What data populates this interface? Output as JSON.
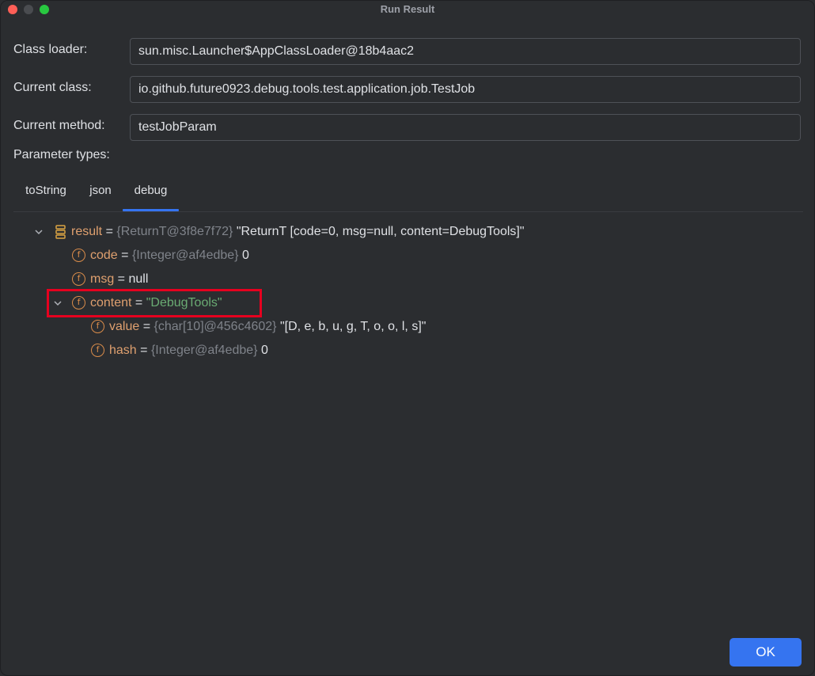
{
  "window": {
    "title": "Run Result"
  },
  "fields": {
    "class_loader": {
      "label": "Class loader:",
      "value": "sun.misc.Launcher$AppClassLoader@18b4aac2"
    },
    "current_class": {
      "label": "Current class:",
      "value": "io.github.future0923.debug.tools.test.application.job.TestJob"
    },
    "current_method": {
      "label": "Current method:",
      "value": "testJobParam"
    },
    "parameter_types": {
      "label": "Parameter types:"
    }
  },
  "tabs": [
    {
      "label": "toString"
    },
    {
      "label": "json"
    },
    {
      "label": "debug",
      "active": true
    }
  ],
  "tree": {
    "result": {
      "name": "result",
      "eq": " = ",
      "type": "{ReturnT@3f8e7f72}",
      "value": " \"ReturnT [code=0, msg=null, content=DebugTools]\""
    },
    "code": {
      "name": "code",
      "eq": " = ",
      "type": "{Integer@af4edbe}",
      "value": " 0"
    },
    "msg": {
      "name": "msg",
      "eq": " = ",
      "value": " null"
    },
    "content": {
      "name": "content",
      "eq": " = ",
      "value": " \"DebugTools\""
    },
    "value": {
      "name": "value",
      "eq": " = ",
      "type": "{char[10]@456c4602}",
      "value": " \"[D, e, b, u, g, T, o, o, l, s]\""
    },
    "hash": {
      "name": "hash",
      "eq": " = ",
      "type": "{Integer@af4edbe}",
      "value": " 0"
    }
  },
  "field_icon_glyph": "f",
  "colors": {
    "accent": "#3574f0",
    "highlight": "#e6001f",
    "field_icon": "#d98c4a",
    "string_value": "#6aab73"
  },
  "buttons": {
    "ok": "OK"
  }
}
